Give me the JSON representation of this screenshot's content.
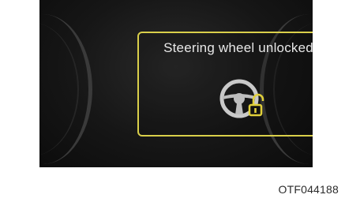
{
  "display": {
    "message": "Steering wheel unlocked",
    "icon": "steering-wheel-unlocked-icon",
    "frame_color": "#d9cf4a",
    "lock_color": "#e0cf3a"
  },
  "figure_code": "OTF044188"
}
